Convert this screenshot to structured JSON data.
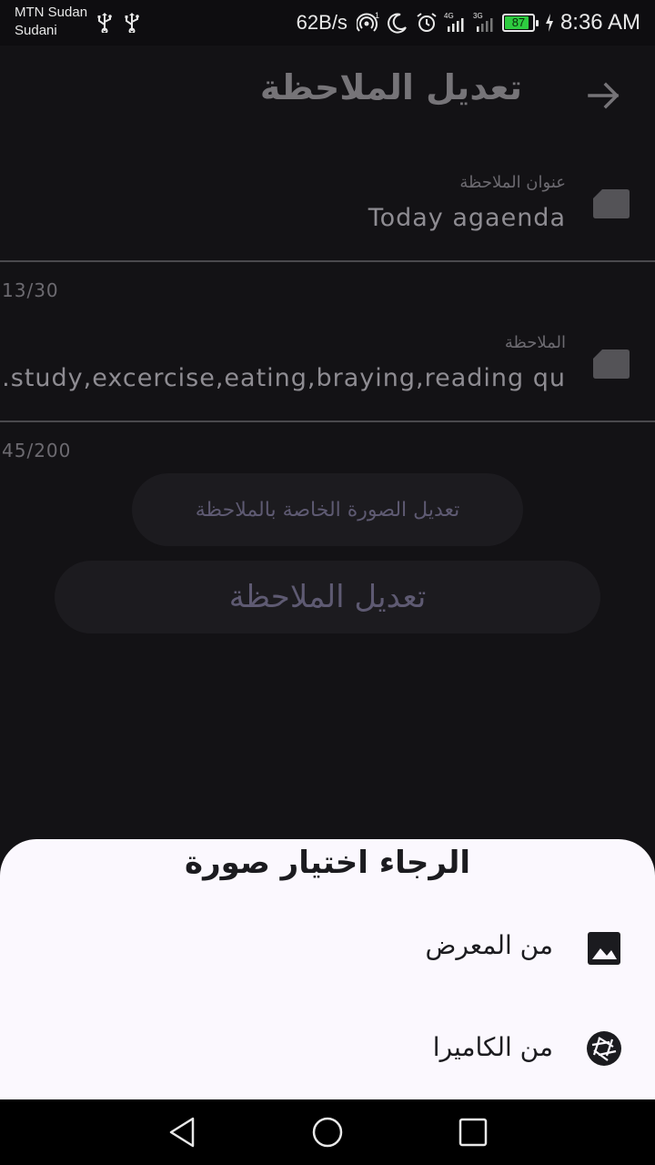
{
  "status_bar": {
    "carrier_line1": "MTN Sudan",
    "carrier_line2": "Sudani",
    "net_speed": "62B/s",
    "battery_percent": 87,
    "battery_label": "87",
    "battery_color": "#2ecc40",
    "time": "8:36 AM",
    "icons": [
      "usb-icon",
      "usb-icon",
      "hotspot-icon",
      "moon-icon",
      "alarm-icon",
      "signal-4g-icon",
      "signal-3g-icon",
      "battery-icon",
      "charging-icon"
    ]
  },
  "app_bar": {
    "title": "تعديل الملاحظة",
    "back_icon": "arrow-forward-icon"
  },
  "form": {
    "title_field": {
      "label": "عنوان الملاحظة",
      "value": "Today agaenda",
      "counter": "13/30",
      "icon": "note-icon"
    },
    "note_field": {
      "label": "الملاحظة",
      "value": ".study,excercise,eating,braying,reading qu",
      "counter": "45/200",
      "icon": "note-icon"
    },
    "edit_image_button": "تعديل الصورة الخاصة بالملاحظة",
    "submit_button": "تعديل الملاحظة"
  },
  "sheet": {
    "title": "الرجاء اختيار صورة",
    "items": [
      {
        "label": "من المعرض",
        "icon": "gallery-image-icon"
      },
      {
        "label": "من الكاميرا",
        "icon": "camera-shutter-icon"
      }
    ],
    "background": "#fbf8fe"
  },
  "nav_bar": {
    "icons": [
      "back-triangle-icon",
      "home-circle-icon",
      "recents-square-icon"
    ]
  },
  "colors": {
    "background": "#131215",
    "button_text": "#5e5a72",
    "button_bg": "#1c1b1f"
  }
}
